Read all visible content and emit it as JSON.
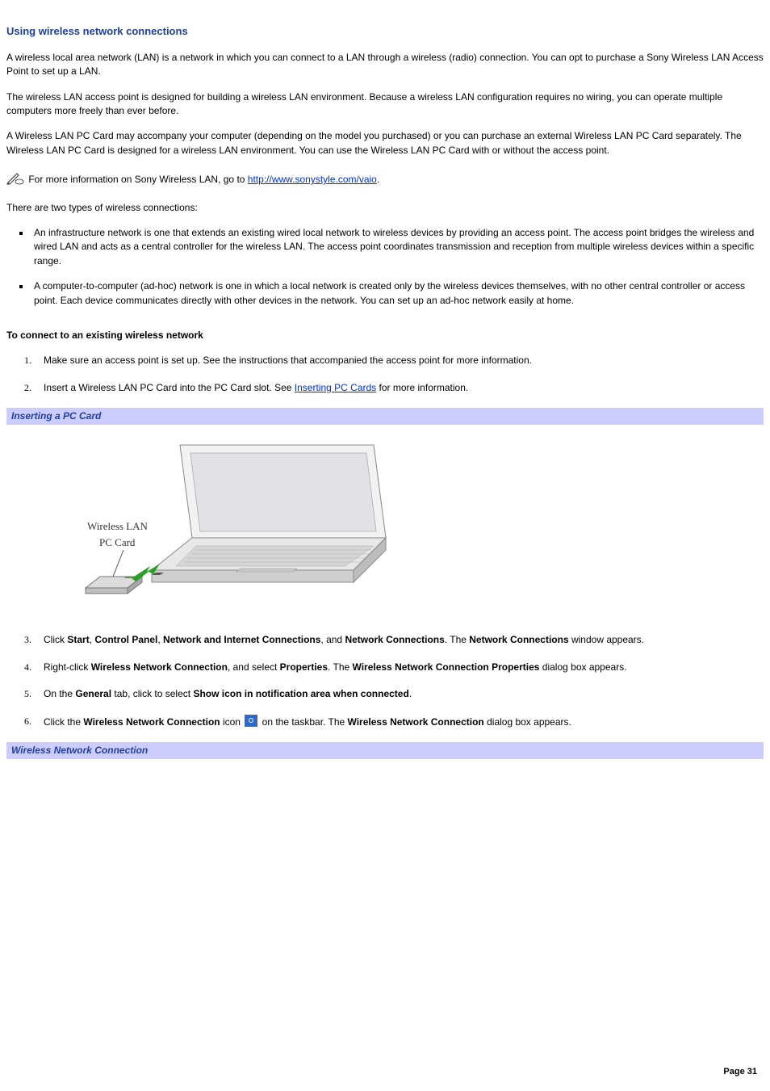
{
  "heading": "Using wireless network connections",
  "para1": "A wireless local area network (LAN) is a network in which you can connect to a LAN through a wireless (radio) connection. You can opt to purchase a Sony Wireless LAN Access Point to set up a LAN.",
  "para2": "The wireless LAN access point is designed for building a wireless LAN environment. Because a wireless LAN configuration requires no wiring, you can operate multiple computers more freely than ever before.",
  "para3": "A Wireless LAN PC Card may accompany your computer (depending on the model you purchased) or you can purchase an external Wireless LAN PC Card separately. The Wireless LAN PC Card is designed for a wireless LAN environment. You can use the Wireless LAN PC Card with or without the access point.",
  "note": {
    "pre": "For more information on Sony Wireless LAN, go to ",
    "url": "http://www.sonystyle.com/vaio",
    "post": "."
  },
  "para4": "There are two types of wireless connections:",
  "bullets": [
    "An infrastructure network is one that extends an existing wired local network to wireless devices by providing an access point. The access point bridges the wireless and wired LAN and acts as a central controller for the wireless LAN. The access point coordinates transmission and reception from multiple wireless devices within a specific range.",
    "A computer-to-computer (ad-hoc) network is one in which a local network is created only by the wireless devices themselves, with no other central controller or access point. Each device communicates directly with other devices in the network. You can set up an ad-hoc network easily at home."
  ],
  "subheading": "To connect to an existing wireless network",
  "steps": {
    "s1": "Make sure an access point is set up. See the instructions that accompanied the access point for more information.",
    "s2": {
      "pre": "Insert a Wireless LAN PC Card into the PC Card slot. See ",
      "link": "Inserting PC Cards",
      "post": " for more information."
    },
    "s3": {
      "t1": "Click ",
      "b1": "Start",
      "t2": ", ",
      "b2": "Control Panel",
      "t3": ", ",
      "b3": "Network and Internet Connections",
      "t4": ", and ",
      "b4": "Network Connections",
      "t5": ". The ",
      "b5": "Network Connections",
      "t6": " window appears."
    },
    "s4": {
      "t1": "Right-click ",
      "b1": "Wireless Network Connection",
      "t2": ", and select ",
      "b2": "Properties",
      "t3": ". The ",
      "b3": "Wireless Network Connection Properties",
      "t4": " dialog box appears."
    },
    "s5": {
      "t1": "On the ",
      "b1": "General",
      "t2": " tab, click to select ",
      "b2": "Show icon in notification area when connected",
      "t3": "."
    },
    "s6": {
      "t1": "Click the ",
      "b1": "Wireless Network Connection",
      "t2": " icon ",
      "t3": " on the taskbar. The ",
      "b2": "Wireless Network Connection",
      "t4": " dialog box appears."
    }
  },
  "fig1": {
    "caption": "Inserting a PC Card",
    "label1": "Wireless LAN",
    "label2": "PC Card"
  },
  "fig2": {
    "caption": "Wireless Network Connection"
  },
  "page": "Page 31"
}
